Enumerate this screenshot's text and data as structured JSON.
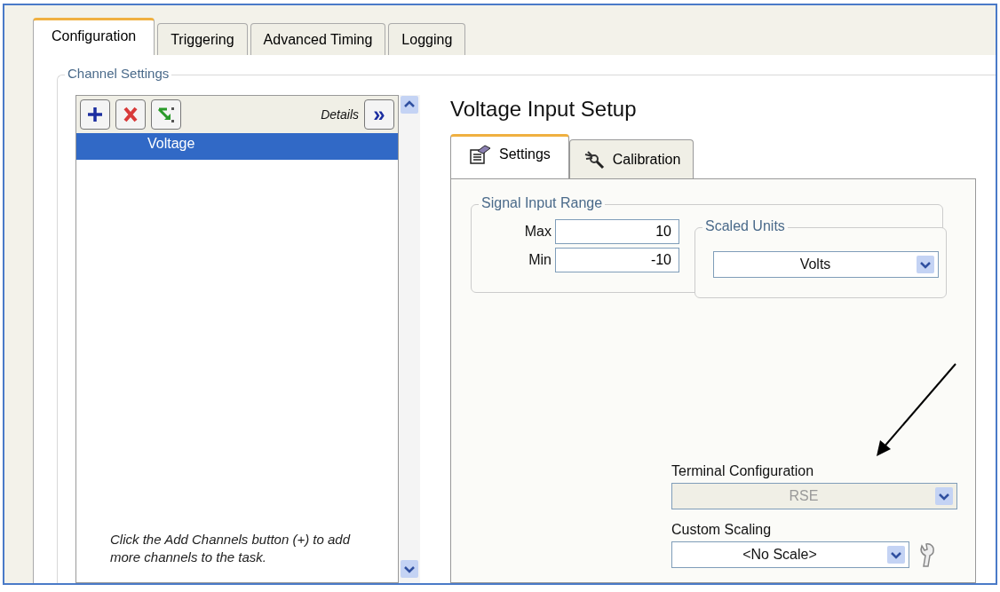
{
  "tabs": [
    {
      "label": "Configuration",
      "selected": true
    },
    {
      "label": "Triggering",
      "selected": false
    },
    {
      "label": "Advanced Timing",
      "selected": false
    },
    {
      "label": "Logging",
      "selected": false
    }
  ],
  "channel_settings": {
    "title": "Channel Settings",
    "details_label": "Details",
    "details_button": "»",
    "channels": [
      {
        "name": "Voltage",
        "selected": true
      }
    ],
    "hint": "Click the Add Channels button (+) to add more channels to the task."
  },
  "setup": {
    "title": "Voltage Input Setup",
    "tabs": [
      {
        "label": "Settings",
        "selected": true,
        "kind": "settings"
      },
      {
        "label": "Calibration",
        "selected": false,
        "kind": "calibration"
      }
    ],
    "signal_input_range": {
      "title": "Signal Input Range",
      "max_label": "Max",
      "max": "10",
      "min_label": "Min",
      "min": "-10"
    },
    "scaled_units": {
      "title": "Scaled Units",
      "value": "Volts"
    },
    "terminal_configuration": {
      "label": "Terminal Configuration",
      "value": "RSE",
      "disabled": true
    },
    "custom_scaling": {
      "label": "Custom Scaling",
      "value": "<No Scale>",
      "disabled": false
    }
  }
}
